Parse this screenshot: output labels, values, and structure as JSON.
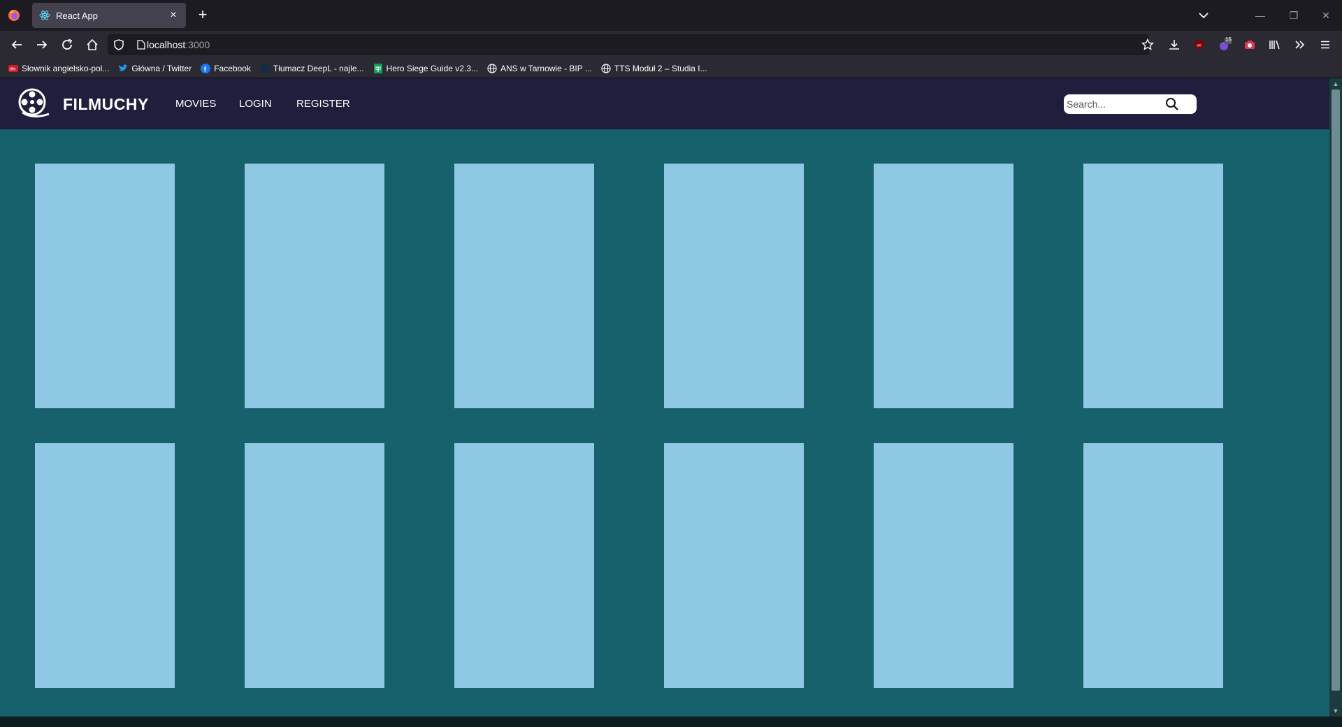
{
  "browser": {
    "tab": {
      "title": "React App"
    },
    "url": {
      "host": "localhost",
      "port": ":3000"
    },
    "bookmarks": [
      {
        "label": "Słownik angielsko-pol...",
        "icon": "diki-icon"
      },
      {
        "label": "Główna / Twitter",
        "icon": "twitter-icon"
      },
      {
        "label": "Facebook",
        "icon": "facebook-icon"
      },
      {
        "label": "Tłumacz DeepL - najle...",
        "icon": "deepl-icon"
      },
      {
        "label": "Hero Siege Guide v2.3...",
        "icon": "sheets-icon"
      },
      {
        "label": "ANS w Tarnowie - BIP ...",
        "icon": "globe-icon"
      },
      {
        "label": "TTS Moduł 2 – Studia I...",
        "icon": "globe-icon"
      }
    ],
    "toolbar": {
      "extension_badge": "15"
    }
  },
  "site": {
    "brand": "FILMUCHY",
    "nav": [
      {
        "label": "MOVIES"
      },
      {
        "label": "LOGIN"
      },
      {
        "label": "REGISTER"
      }
    ],
    "search": {
      "placeholder": "Search..."
    }
  },
  "colors": {
    "header_bg": "#1f1f3d",
    "page_bg": "#16616b",
    "card_bg": "#8fc8e4"
  },
  "movies": {
    "rows": 2,
    "columns": 6
  }
}
